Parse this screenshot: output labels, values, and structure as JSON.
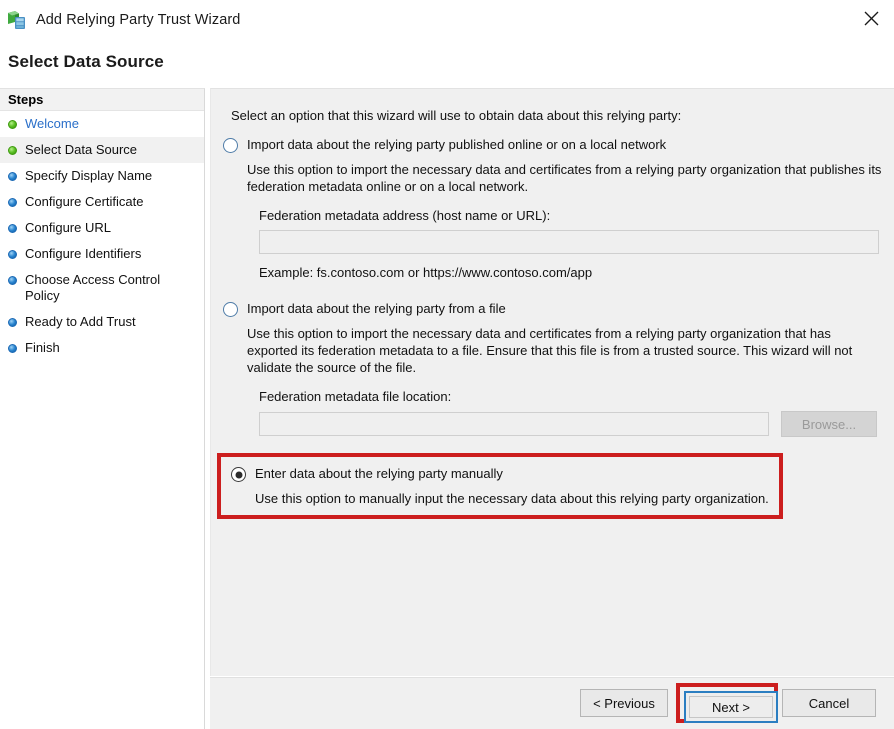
{
  "window": {
    "title": "Add Relying Party Trust Wizard",
    "icon": "adfs-server-shield-icon",
    "close_label": "close-icon"
  },
  "page": {
    "heading": "Select Data Source"
  },
  "sidebar": {
    "header": "Steps",
    "items": [
      {
        "label": "Welcome",
        "state": "done",
        "style": "link"
      },
      {
        "label": "Select Data Source",
        "state": "done",
        "style": "current"
      },
      {
        "label": "Specify Display Name",
        "state": "todo",
        "style": "normal"
      },
      {
        "label": "Configure Certificate",
        "state": "todo",
        "style": "normal"
      },
      {
        "label": "Configure URL",
        "state": "todo",
        "style": "normal"
      },
      {
        "label": "Configure Identifiers",
        "state": "todo",
        "style": "normal"
      },
      {
        "label": "Choose Access Control Policy",
        "state": "todo",
        "style": "normal"
      },
      {
        "label": "Ready to Add Trust",
        "state": "todo",
        "style": "normal"
      },
      {
        "label": "Finish",
        "state": "todo",
        "style": "normal"
      }
    ]
  },
  "main": {
    "intro": "Select an option that this wizard will use to obtain data about this relying party:",
    "options": [
      {
        "id": "import-online",
        "label": "Import data about the relying party published online or on a local network",
        "selected": false,
        "description": "Use this option to import the necessary data and certificates from a relying party organization that publishes its federation metadata online or on a local network.",
        "field_label": "Federation metadata address (host name or URL):",
        "field_value": "",
        "field_placeholder": "",
        "example": "Example: fs.contoso.com or https://www.contoso.com/app"
      },
      {
        "id": "import-file",
        "label": "Import data about the relying party from a file",
        "selected": false,
        "description": "Use this option to import the necessary data and certificates from a relying party organization that has exported its federation metadata to a file. Ensure that this file is from a trusted source.  This wizard will not validate the source of the file.",
        "field_label": "Federation metadata file location:",
        "field_value": "",
        "field_placeholder": "",
        "browse_label": "Browse..."
      },
      {
        "id": "manual",
        "label": "Enter data about the relying party manually",
        "selected": true,
        "description": "Use this option to manually input the necessary data about this relying party organization.",
        "highlighted": true
      }
    ]
  },
  "footer": {
    "previous_label": "< Previous",
    "next_label": "Next >",
    "cancel_label": "Cancel",
    "next_focused": true,
    "next_highlighted": true
  },
  "colors": {
    "annotation_red": "#cc1e1e",
    "focus_blue": "#2b7ec1",
    "link_blue": "#2a6fc9",
    "step_done_green": "#5ec127",
    "step_todo_blue": "#2a85d0",
    "panel_gray": "#f0f0f0"
  }
}
